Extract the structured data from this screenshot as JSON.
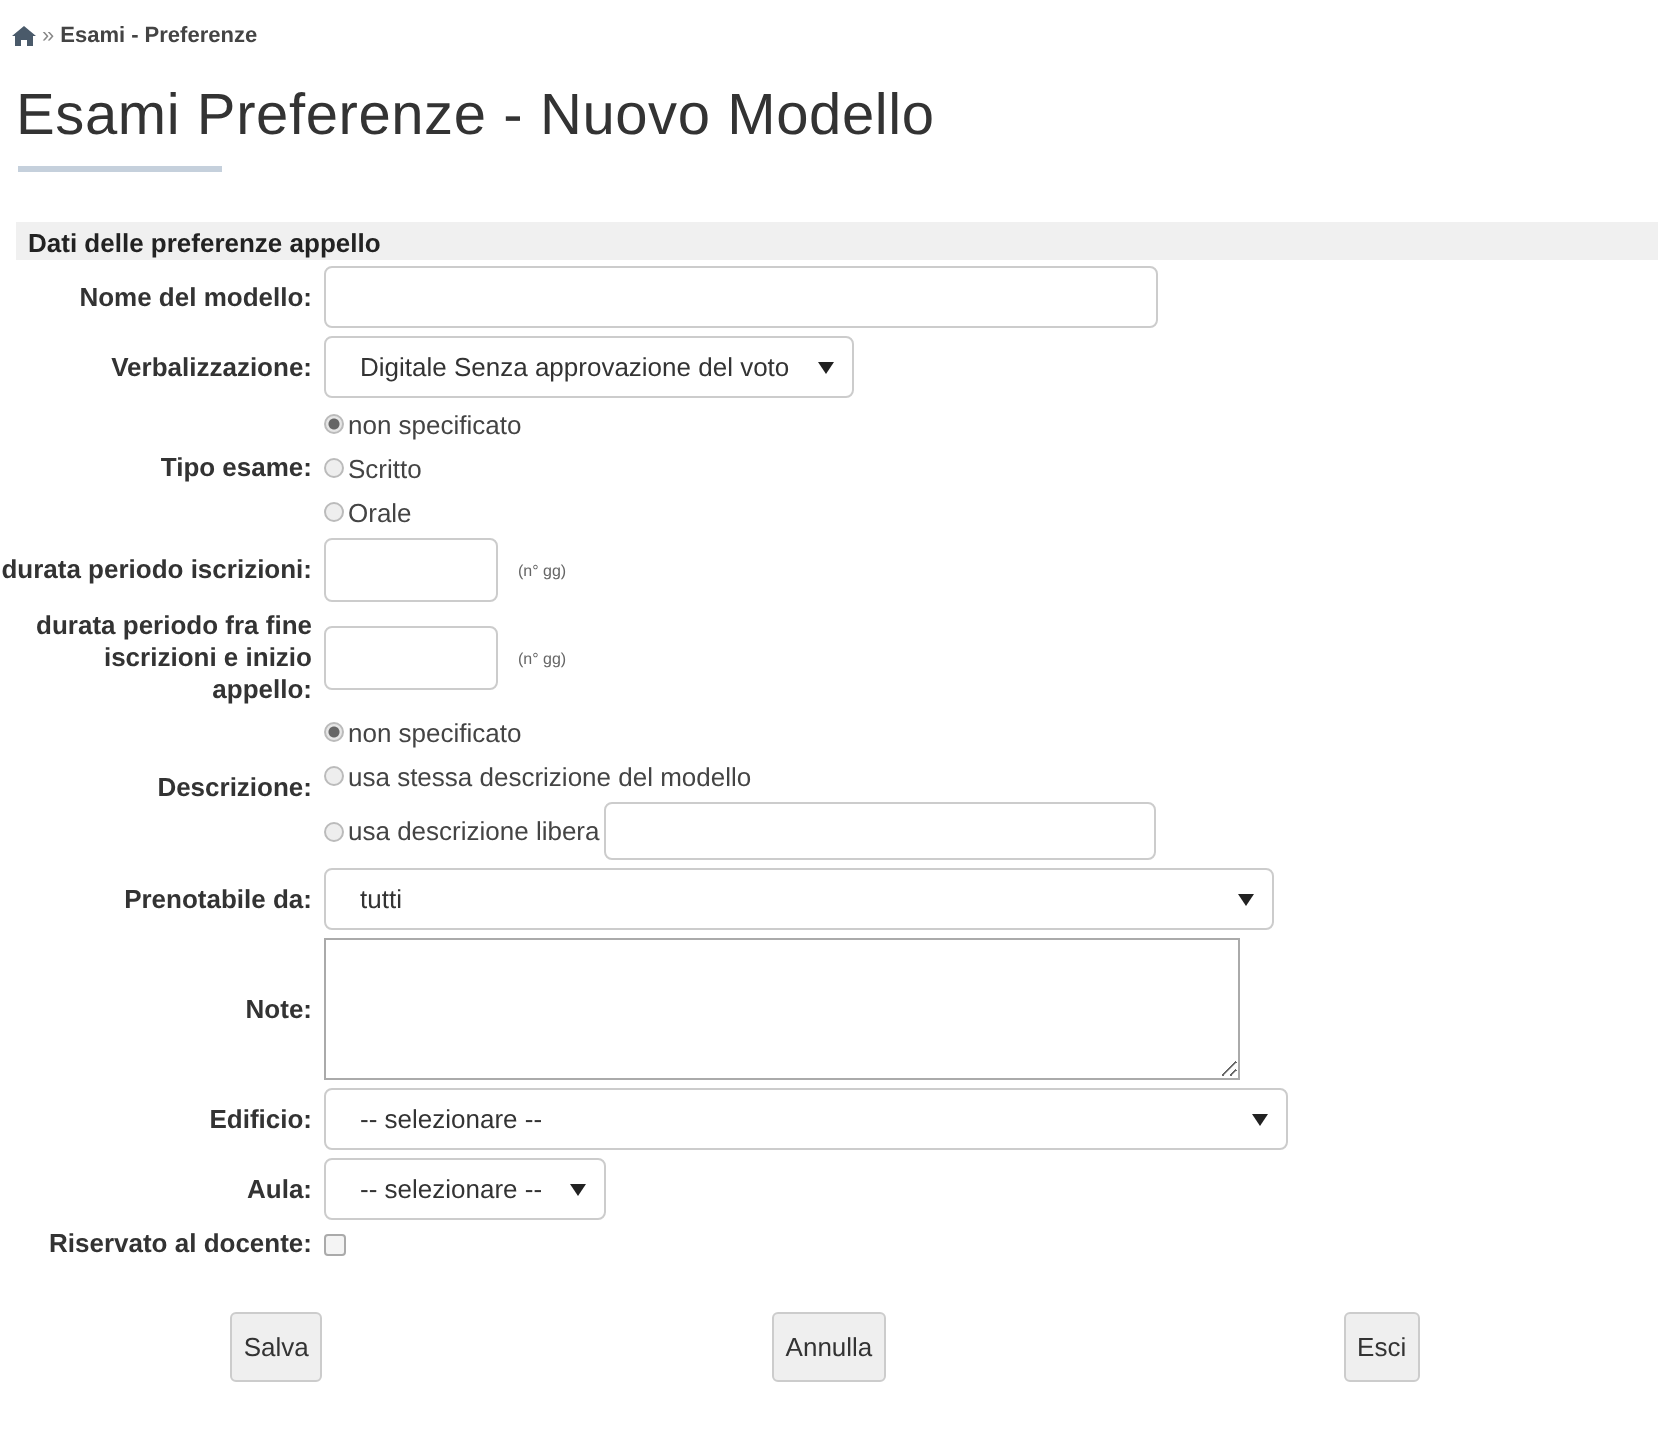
{
  "breadcrumb": {
    "current": "Esami - Preferenze",
    "separator": "»"
  },
  "title": "Esami Preferenze - Nuovo Modello",
  "section": {
    "title": "Dati delle preferenze appello"
  },
  "fields": [
    {
      "kind": "text",
      "label": "Nome del modello:"
    },
    {
      "kind": "select",
      "label": "Verbalizzazione:",
      "value": "Digitale Senza approvazione del voto"
    },
    {
      "kind": "radio",
      "label": "Tipo esame:",
      "options": [
        {
          "label": "non specificato",
          "selected": true
        },
        {
          "label": "Scritto",
          "selected": false
        },
        {
          "label": "Orale",
          "selected": false
        }
      ]
    },
    {
      "kind": "days",
      "label": "durata periodo iscrizioni:",
      "unit": "(n° gg)"
    },
    {
      "kind": "days",
      "label": "durata periodo fra fine iscrizioni e inizio appello:",
      "unit": "(n° gg)"
    },
    {
      "kind": "radio",
      "label": "Descrizione:",
      "options": [
        {
          "label": "non specificato",
          "selected": true
        },
        {
          "label": "usa stessa descrizione del modello",
          "selected": false
        },
        {
          "label": "usa descrizione libera",
          "selected": false,
          "has_input": true
        }
      ]
    },
    {
      "kind": "select",
      "label": "Prenotabile da:",
      "value": "tutti"
    },
    {
      "kind": "textarea",
      "label": "Note:"
    },
    {
      "kind": "select",
      "label": "Edificio:",
      "value": "-- selezionare --"
    },
    {
      "kind": "select",
      "label": "Aula:",
      "value": "-- selezionare --"
    },
    {
      "kind": "checkbox",
      "label": "Riservato al docente:",
      "checked": false
    }
  ],
  "buttons": [
    "Salva",
    "Annulla",
    "Esci"
  ]
}
